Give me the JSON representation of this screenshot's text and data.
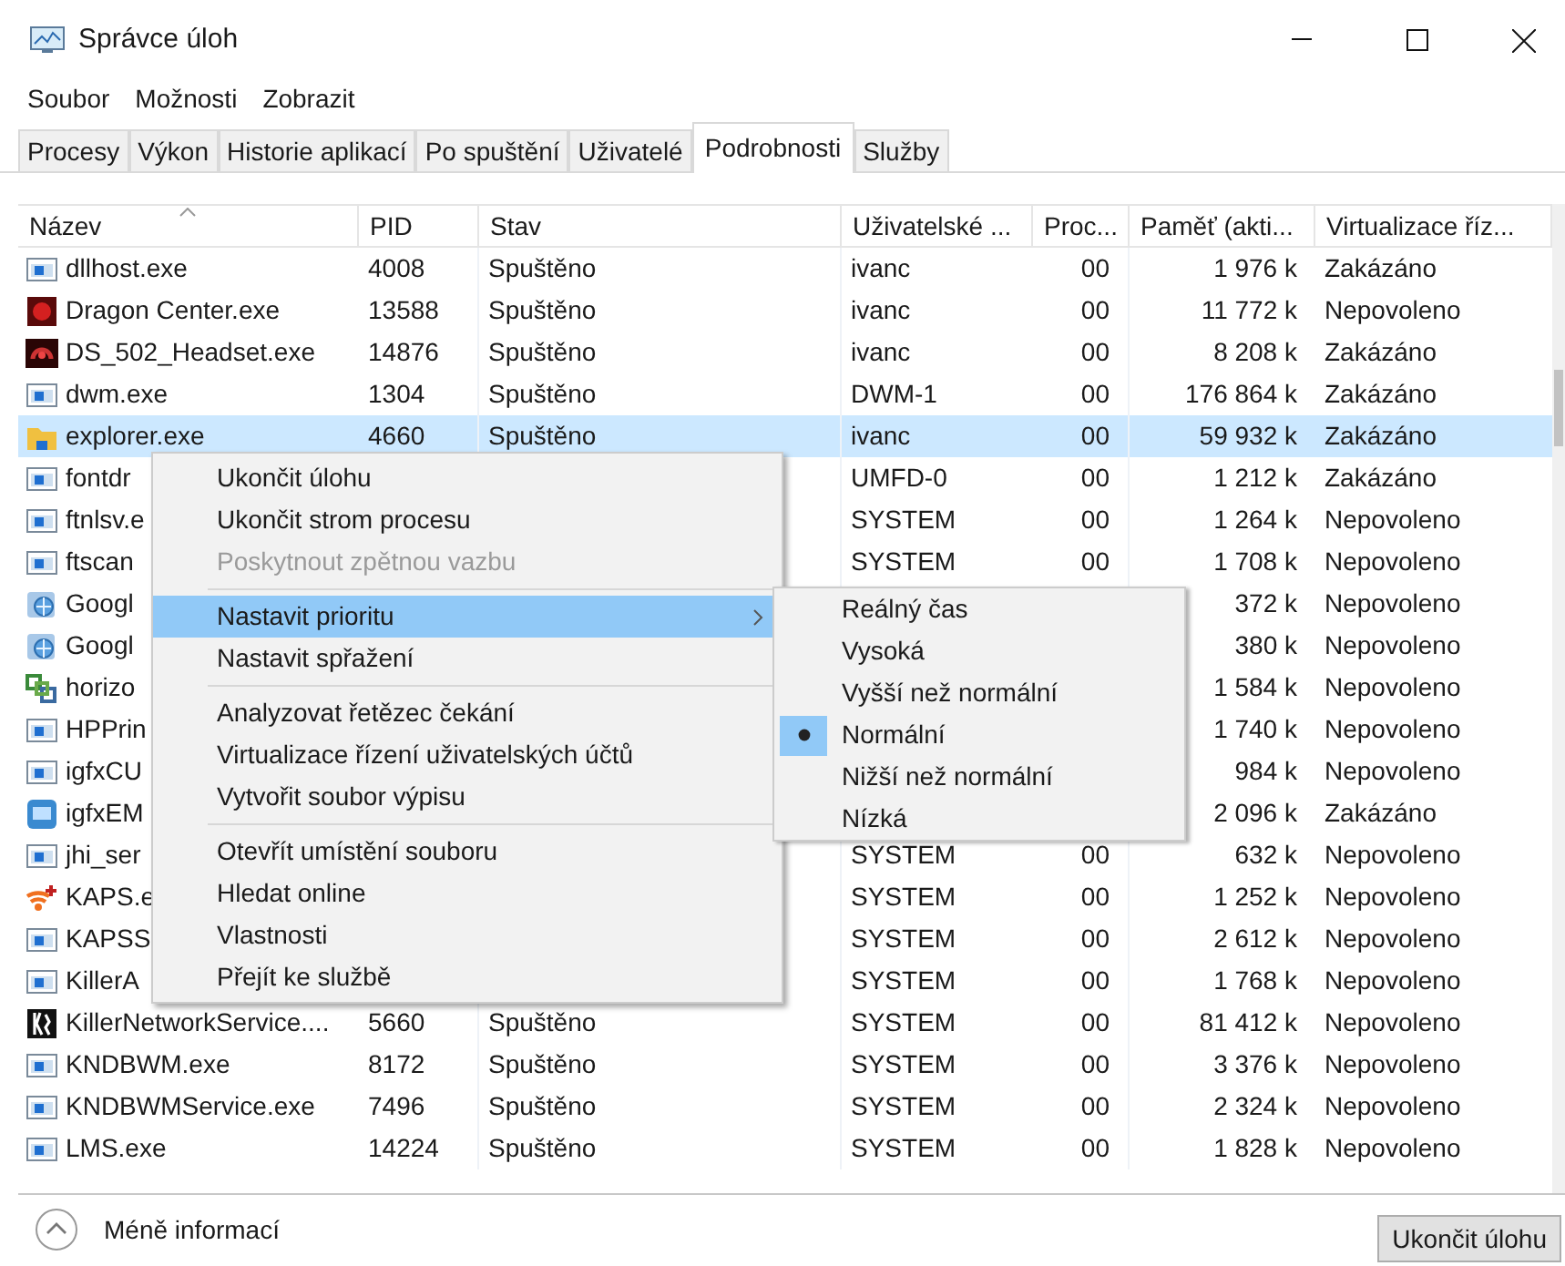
{
  "window": {
    "title": "Správce úloh"
  },
  "menu_bar": [
    "Soubor",
    "Možnosti",
    "Zobrazit"
  ],
  "tabs": [
    {
      "label": "Procesy",
      "selected": false
    },
    {
      "label": "Výkon",
      "selected": false
    },
    {
      "label": "Historie aplikací",
      "selected": false
    },
    {
      "label": "Po spuštění",
      "selected": false
    },
    {
      "label": "Uživatelé",
      "selected": false
    },
    {
      "label": "Podrobnosti",
      "selected": true
    },
    {
      "label": "Služby",
      "selected": false
    }
  ],
  "table": {
    "columns": [
      {
        "label": "Název",
        "sorted": true
      },
      {
        "label": "PID",
        "sorted": false
      },
      {
        "label": "Stav",
        "sorted": false
      },
      {
        "label": "Uživatelské ...",
        "sorted": false
      },
      {
        "label": "Proc...",
        "sorted": false
      },
      {
        "label": "Paměť (akti...",
        "sorted": false
      },
      {
        "label": "Virtualizace říz...",
        "sorted": false
      }
    ],
    "rows": [
      {
        "kind": "app",
        "selected": false,
        "name": "dllhost.exe",
        "pid": "4008",
        "status": "Spuštěno",
        "user": "ivanc",
        "cpu": "00",
        "memory": "1 976 k",
        "uac": "Zakázáno"
      },
      {
        "kind": "dragon",
        "selected": false,
        "name": "Dragon Center.exe",
        "pid": "13588",
        "status": "Spuštěno",
        "user": "ivanc",
        "cpu": "00",
        "memory": "11 772 k",
        "uac": "Nepovoleno"
      },
      {
        "kind": "headset",
        "selected": false,
        "name": "DS_502_Headset.exe",
        "pid": "14876",
        "status": "Spuštěno",
        "user": "ivanc",
        "cpu": "00",
        "memory": "8 208 k",
        "uac": "Zakázáno"
      },
      {
        "kind": "app",
        "selected": false,
        "name": "dwm.exe",
        "pid": "1304",
        "status": "Spuštěno",
        "user": "DWM-1",
        "cpu": "00",
        "memory": "176 864 k",
        "uac": "Zakázáno"
      },
      {
        "kind": "folder",
        "selected": true,
        "name": "explorer.exe",
        "pid": "4660",
        "status": "Spuštěno",
        "user": "ivanc",
        "cpu": "00",
        "memory": "59 932 k",
        "uac": "Zakázáno"
      },
      {
        "kind": "app",
        "selected": false,
        "name": "fontdr",
        "user": "UMFD-0",
        "cpu": "00",
        "memory": "1 212 k",
        "uac": "Zakázáno"
      },
      {
        "kind": "app",
        "selected": false,
        "name": "ftnlsv.e",
        "user": "SYSTEM",
        "cpu": "00",
        "memory": "1 264 k",
        "uac": "Nepovoleno"
      },
      {
        "kind": "app",
        "selected": false,
        "name": "ftscan",
        "user": "SYSTEM",
        "cpu": "00",
        "memory": "1 708 k",
        "uac": "Nepovoleno"
      },
      {
        "kind": "globe",
        "selected": false,
        "name": "Googl",
        "memory": "372 k",
        "uac": "Nepovoleno"
      },
      {
        "kind": "globe",
        "selected": false,
        "name": "Googl",
        "memory": "380 k",
        "uac": "Nepovoleno"
      },
      {
        "kind": "horizon",
        "selected": false,
        "name": "horizo",
        "memory": "1 584 k",
        "uac": "Nepovoleno"
      },
      {
        "kind": "app",
        "selected": false,
        "name": "HPPrin",
        "memory": "1 740 k",
        "uac": "Nepovoleno"
      },
      {
        "kind": "app",
        "selected": false,
        "name": "igfxCU",
        "memory": "984 k",
        "uac": "Nepovoleno"
      },
      {
        "kind": "igfx",
        "selected": false,
        "name": "igfxEM",
        "memory": "2 096 k",
        "uac": "Zakázáno"
      },
      {
        "kind": "app",
        "selected": false,
        "name": "jhi_ser",
        "user": "SYSTEM",
        "cpu": "00",
        "memory": "632 k",
        "uac": "Nepovoleno"
      },
      {
        "kind": "wifi",
        "selected": false,
        "name": "KAPS.e",
        "user": "SYSTEM",
        "cpu": "00",
        "memory": "1 252 k",
        "uac": "Nepovoleno"
      },
      {
        "kind": "app",
        "selected": false,
        "name": "KAPSS",
        "user": "SYSTEM",
        "cpu": "00",
        "memory": "2 612 k",
        "uac": "Nepovoleno"
      },
      {
        "kind": "app",
        "selected": false,
        "name": "KillerA",
        "user": "SYSTEM",
        "cpu": "00",
        "memory": "1 768 k",
        "uac": "Nepovoleno"
      },
      {
        "kind": "killer",
        "selected": false,
        "name": "KillerNetworkService....",
        "pid": "5660",
        "status": "Spuštěno",
        "user": "SYSTEM",
        "cpu": "00",
        "memory": "81 412 k",
        "uac": "Nepovoleno"
      },
      {
        "kind": "app",
        "selected": false,
        "name": "KNDBWM.exe",
        "pid": "8172",
        "status": "Spuštěno",
        "user": "SYSTEM",
        "cpu": "00",
        "memory": "3 376 k",
        "uac": "Nepovoleno"
      },
      {
        "kind": "app",
        "selected": false,
        "name": "KNDBWMService.exe",
        "pid": "7496",
        "status": "Spuštěno",
        "user": "SYSTEM",
        "cpu": "00",
        "memory": "2 324 k",
        "uac": "Nepovoleno"
      },
      {
        "kind": "app",
        "selected": false,
        "name": "LMS.exe",
        "pid": "14224",
        "status": "Spuštěno",
        "user": "SYSTEM",
        "cpu": "00",
        "memory": "1 828 k",
        "uac": "Nepovoleno"
      }
    ]
  },
  "context_menu": {
    "groups": [
      [
        {
          "label": "Ukončit úlohu",
          "disabled": false,
          "selected": false,
          "submenu": false
        },
        {
          "label": "Ukončit strom procesu",
          "disabled": false,
          "selected": false,
          "submenu": false
        },
        {
          "label": "Poskytnout zpětnou vazbu",
          "disabled": true,
          "selected": false,
          "submenu": false
        }
      ],
      [
        {
          "label": "Nastavit prioritu",
          "disabled": false,
          "selected": true,
          "submenu": true
        },
        {
          "label": "Nastavit spřažení",
          "disabled": false,
          "selected": false,
          "submenu": false
        }
      ],
      [
        {
          "label": "Analyzovat řetězec čekání",
          "disabled": false,
          "selected": false,
          "submenu": false
        },
        {
          "label": "Virtualizace řízení uživatelských účtů",
          "disabled": false,
          "selected": false,
          "submenu": false
        },
        {
          "label": "Vytvořit soubor výpisu",
          "disabled": false,
          "selected": false,
          "submenu": false
        }
      ],
      [
        {
          "label": "Otevřít umístění souboru",
          "disabled": false,
          "selected": false,
          "submenu": false
        },
        {
          "label": "Hledat online",
          "disabled": false,
          "selected": false,
          "submenu": false
        },
        {
          "label": "Vlastnosti",
          "disabled": false,
          "selected": false,
          "submenu": false
        },
        {
          "label": "Přejít ke službě",
          "disabled": false,
          "selected": false,
          "submenu": false
        }
      ]
    ]
  },
  "priority_submenu": [
    {
      "label": "Reálný čas",
      "checked": false
    },
    {
      "label": "Vysoká",
      "checked": false
    },
    {
      "label": "Vyšší než normální",
      "checked": false
    },
    {
      "label": "Normální",
      "checked": true
    },
    {
      "label": "Nižší než normální",
      "checked": false
    },
    {
      "label": "Nízká",
      "checked": false
    }
  ],
  "footer": {
    "toggle": "Méně informací",
    "button": "Ukončit úlohu"
  }
}
